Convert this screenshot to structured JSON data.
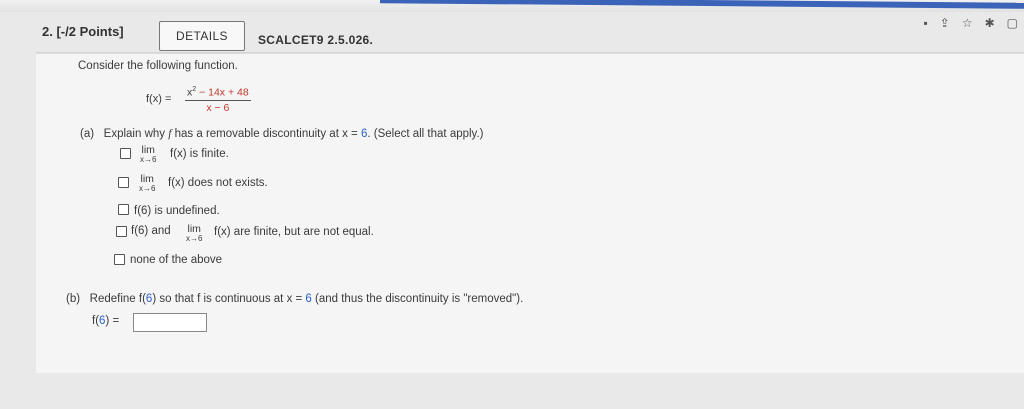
{
  "browser": {
    "icons": [
      "cast-icon",
      "share-icon",
      "star-icon",
      "extension-icon",
      "window-icon"
    ]
  },
  "question": {
    "number": "2.",
    "points": "[-/2 Points]",
    "details_label": "DETAILS",
    "code": "SCALCET9 2.5.026.",
    "prompt": "Consider the following function.",
    "function": {
      "lhs": "f(x) =",
      "numerator_x": "x",
      "numerator_exp": "2",
      "numerator_rest": "− 14x + 48",
      "denominator": "x − 6"
    }
  },
  "part_a": {
    "label": "(a)",
    "text_pre": "Explain why ",
    "f": "f",
    "text_mid": " has a removable discontinuity at x = ",
    "value": "6",
    "text_post": ". (Select all that apply.)",
    "options": [
      {
        "lim": "lim",
        "sub": "x→6",
        "text": "f(x) is finite."
      },
      {
        "lim": "lim",
        "sub": "x→6",
        "text": "f(x) does not exists."
      },
      {
        "text": "f(6) is undefined."
      },
      {
        "pre": "f(6) and",
        "lim": "lim",
        "sub": "x→6",
        "text": "f(x) are finite, but are not equal."
      },
      {
        "text": "none of the above"
      }
    ]
  },
  "part_b": {
    "label": "(b)",
    "text_pre": "Redefine f(",
    "value1": "6",
    "text_mid": ") so that f is continuous at x = ",
    "value2": "6",
    "text_post": " (and thus the discontinuity is \"removed\").",
    "answer_label_pre": "f(",
    "answer_value": "6",
    "answer_label_post": ") =",
    "answer_input": ""
  }
}
